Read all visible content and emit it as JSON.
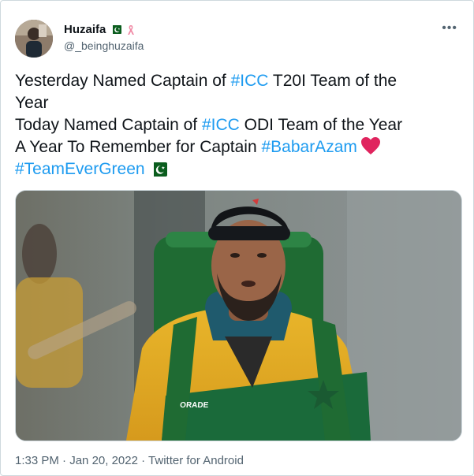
{
  "author": {
    "name": "Huzaifa",
    "handle": "@_beinghuzaifa",
    "avatar_icon": "user-avatar",
    "badges": [
      "pakistan-flag-icon",
      "pink-ribbon-icon"
    ]
  },
  "menu_icon": "more-options-icon",
  "tweet": {
    "line1_a": "Yesterday Named Captain of ",
    "line1_tag": "#ICC",
    "line1_b": " T20I Team of the",
    "line2": "Year",
    "line3_a": "Today Named Captain of ",
    "line3_tag": "#ICC",
    "line3_b": " ODI Team of the Year",
    "line4_a": "A Year To Remember for Captain ",
    "line4_tag": "#BabarAzam",
    "line5_tag": "#TeamEverGreen"
  },
  "media": {
    "icon": "photo-cricketer"
  },
  "meta": {
    "time": "1:33 PM",
    "sep1": " · ",
    "date": "Jan 20, 2022",
    "sep2": " · ",
    "source": "Twitter for Android"
  },
  "colors": {
    "link": "#1d9bf0",
    "text": "#0f1419",
    "secondary": "#536471",
    "heart": "#f91880",
    "flag_green": "#0b5d1e"
  }
}
